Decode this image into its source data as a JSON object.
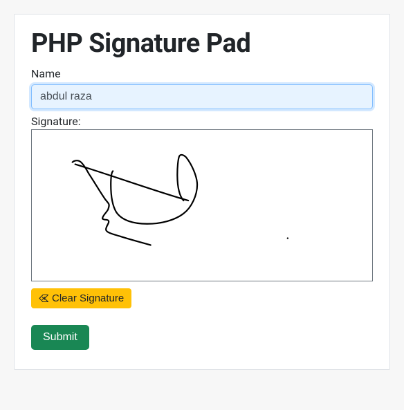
{
  "title": "PHP Signature Pad",
  "form": {
    "name_label": "Name",
    "name_value": "abdul raza ",
    "signature_label": "Signature:",
    "clear_button": "Clear Signature",
    "submit_button": "Submit"
  }
}
